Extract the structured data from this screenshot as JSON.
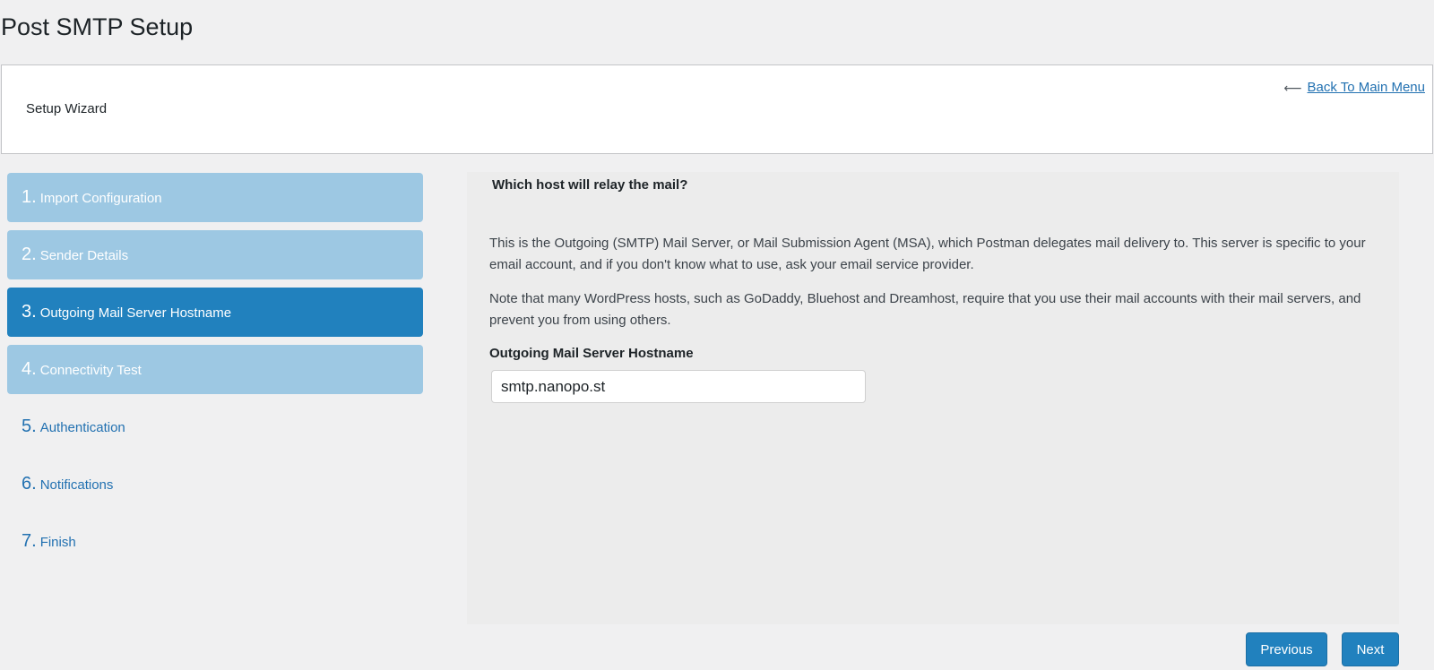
{
  "page": {
    "title": "Post SMTP Setup"
  },
  "header": {
    "title": "Setup Wizard",
    "back_link": {
      "icon": "arrow-left-icon",
      "arrow": "⟵",
      "label": "Back To Main Menu"
    }
  },
  "steps": [
    {
      "number": "1.",
      "label": "Import Configuration",
      "state": "done"
    },
    {
      "number": "2.",
      "label": "Sender Details",
      "state": "done"
    },
    {
      "number": "3.",
      "label": "Outgoing Mail Server Hostname",
      "state": "active"
    },
    {
      "number": "4.",
      "label": "Connectivity Test",
      "state": "done"
    },
    {
      "number": "5.",
      "label": "Authentication",
      "state": "todo"
    },
    {
      "number": "6.",
      "label": "Notifications",
      "state": "todo"
    },
    {
      "number": "7.",
      "label": "Finish",
      "state": "todo"
    }
  ],
  "content": {
    "question": "Which host will relay the mail?",
    "paragraph1": "This is the Outgoing (SMTP) Mail Server, or Mail Submission Agent (MSA), which Postman delegates mail delivery to. This server is specific to your email account, and if you don't know what to use, ask your email service provider.",
    "paragraph2": "Note that many WordPress hosts, such as GoDaddy, Bluehost and Dreamhost, require that you use their mail accounts with their mail servers, and prevent you from using others.",
    "field_label": "Outgoing Mail Server Hostname",
    "hostname_value": "smtp.nanopo.st"
  },
  "buttons": {
    "previous": "Previous",
    "next": "Next"
  },
  "colors": {
    "step_done": "#9dc8e3",
    "step_active": "#2181be",
    "link": "#2271b1",
    "button": "#2181be"
  }
}
